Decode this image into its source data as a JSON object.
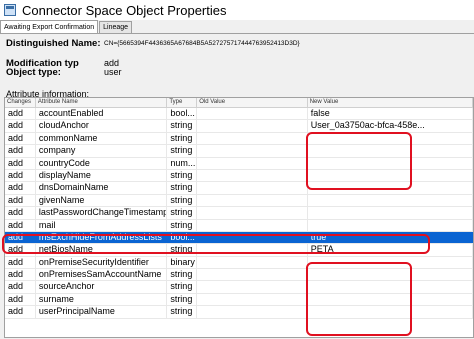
{
  "window": {
    "title": "Connector Space Object Properties"
  },
  "tabs": [
    {
      "label": "Awaiting Export Confirmation",
      "active": true
    },
    {
      "label": "Lineage",
      "active": false
    }
  ],
  "header": {
    "dn_label": "Distinguished Name:",
    "dn_value": "CN={5665394F4436365A67684B5A527275717444763952413D3D}",
    "mod_type_label": "Modification typ",
    "mod_type_value": "add",
    "obj_type_label": "Object type:",
    "obj_type_value": "user"
  },
  "section_label": "Attribute information:",
  "columns": [
    "Changes",
    "Attribute Name",
    "Type",
    "Old Value",
    "New Value"
  ],
  "rows": [
    {
      "change": "add",
      "name": "accountEnabled",
      "type": "bool...",
      "old": "",
      "new": "false"
    },
    {
      "change": "add",
      "name": "cloudAnchor",
      "type": "string",
      "old": "",
      "new": "User_0a3750ac-bfca-458e..."
    },
    {
      "change": "add",
      "name": "commonName",
      "type": "string",
      "old": "",
      "new": ""
    },
    {
      "change": "add",
      "name": "company",
      "type": "string",
      "old": "",
      "new": ""
    },
    {
      "change": "add",
      "name": "countryCode",
      "type": "num...",
      "old": "",
      "new": ""
    },
    {
      "change": "add",
      "name": "displayName",
      "type": "string",
      "old": "",
      "new": ""
    },
    {
      "change": "add",
      "name": "dnsDomainName",
      "type": "string",
      "old": "",
      "new": ""
    },
    {
      "change": "add",
      "name": "givenName",
      "type": "string",
      "old": "",
      "new": ""
    },
    {
      "change": "add",
      "name": "lastPasswordChangeTimestamp",
      "type": "string",
      "old": "",
      "new": ""
    },
    {
      "change": "add",
      "name": "mail",
      "type": "string",
      "old": "",
      "new": ""
    },
    {
      "change": "add",
      "name": "msExchHideFromAddressLists",
      "type": "bool...",
      "old": "",
      "new": "true",
      "selected": true
    },
    {
      "change": "add",
      "name": "netBiosName",
      "type": "string",
      "old": "",
      "new": "PETA"
    },
    {
      "change": "add",
      "name": "onPremiseSecurityIdentifier",
      "type": "binary",
      "old": "",
      "new": ""
    },
    {
      "change": "add",
      "name": "onPremisesSamAccountName",
      "type": "string",
      "old": "",
      "new": ""
    },
    {
      "change": "add",
      "name": "sourceAnchor",
      "type": "string",
      "old": "",
      "new": ""
    },
    {
      "change": "add",
      "name": "surname",
      "type": "string",
      "old": "",
      "new": ""
    },
    {
      "change": "add",
      "name": "userPrincipalName",
      "type": "string",
      "old": "",
      "new": ""
    }
  ],
  "colors": {
    "selection": "#0a64d2",
    "annotation": "#e01020"
  }
}
